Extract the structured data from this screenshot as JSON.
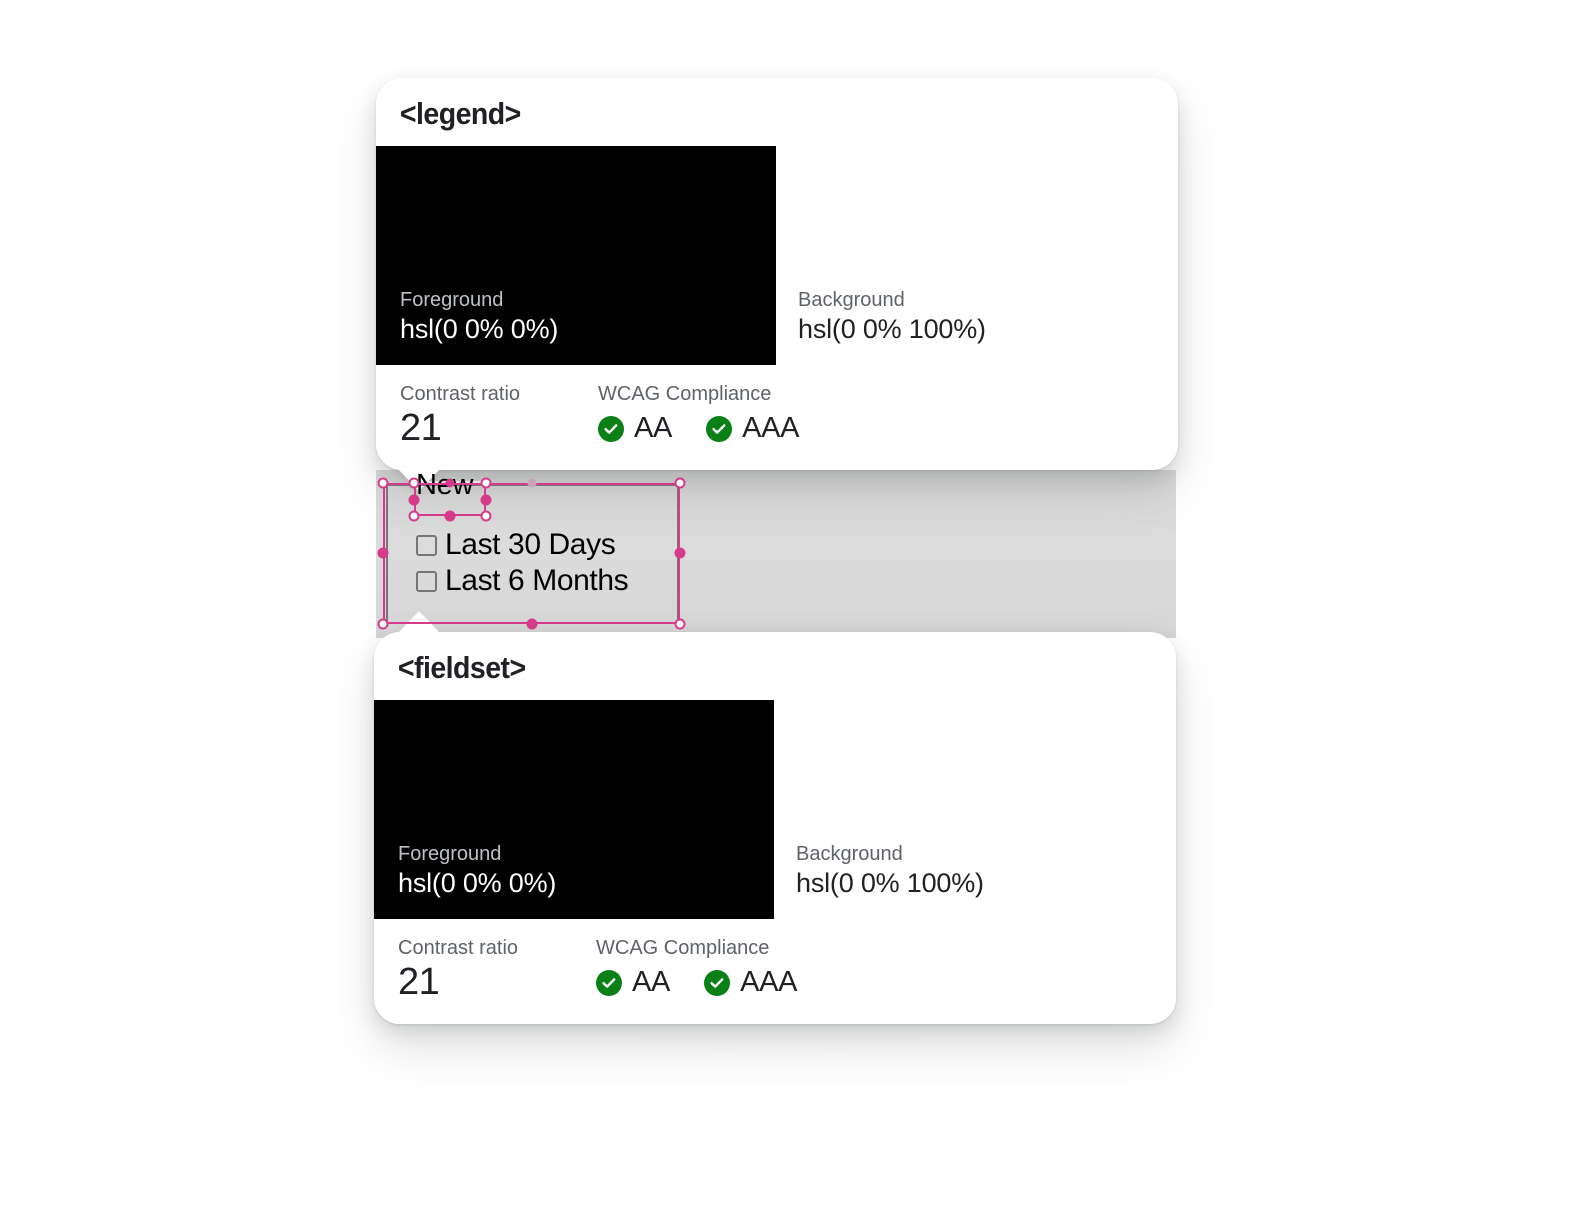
{
  "page": {
    "background_color": "#ffffff",
    "accent_pink": "#d63b8b",
    "badge_green": "#0b8017",
    "swatch_black": "#000000",
    "swatch_white": "#ffffff"
  },
  "cards": [
    {
      "id": "legend",
      "title": "<legend>",
      "tail": "down",
      "foreground": {
        "label": "Foreground",
        "value": "hsl(0 0% 0%)",
        "color": "#000000"
      },
      "background": {
        "label": "Background",
        "value": "hsl(0 0% 100%)",
        "color": "#ffffff"
      },
      "contrast": {
        "label": "Contrast ratio",
        "value": "21"
      },
      "wcag": {
        "label": "WCAG Compliance",
        "badges": [
          {
            "level": "AA",
            "passed": true,
            "icon": "check-circle-icon"
          },
          {
            "level": "AAA",
            "passed": true,
            "icon": "check-circle-icon"
          }
        ]
      }
    },
    {
      "id": "fieldset",
      "title": "<fieldset>",
      "tail": "up",
      "foreground": {
        "label": "Foreground",
        "value": "hsl(0 0% 0%)",
        "color": "#000000"
      },
      "background": {
        "label": "Background",
        "value": "hsl(0 0% 100%)",
        "color": "#ffffff"
      },
      "contrast": {
        "label": "Contrast ratio",
        "value": "21"
      },
      "wcag": {
        "label": "WCAG Compliance",
        "badges": [
          {
            "level": "AA",
            "passed": true,
            "icon": "check-circle-icon"
          },
          {
            "level": "AAA",
            "passed": true,
            "icon": "check-circle-icon"
          }
        ]
      }
    }
  ],
  "widget": {
    "legend_text": "New",
    "checkboxes": [
      {
        "label": "Last 30 Days",
        "checked": false
      },
      {
        "label": "Last 6 Months",
        "checked": false
      }
    ]
  },
  "selection": {
    "outer_label": "fieldset-selection",
    "inner_label": "legend-selection",
    "color": "#d63b8b"
  }
}
